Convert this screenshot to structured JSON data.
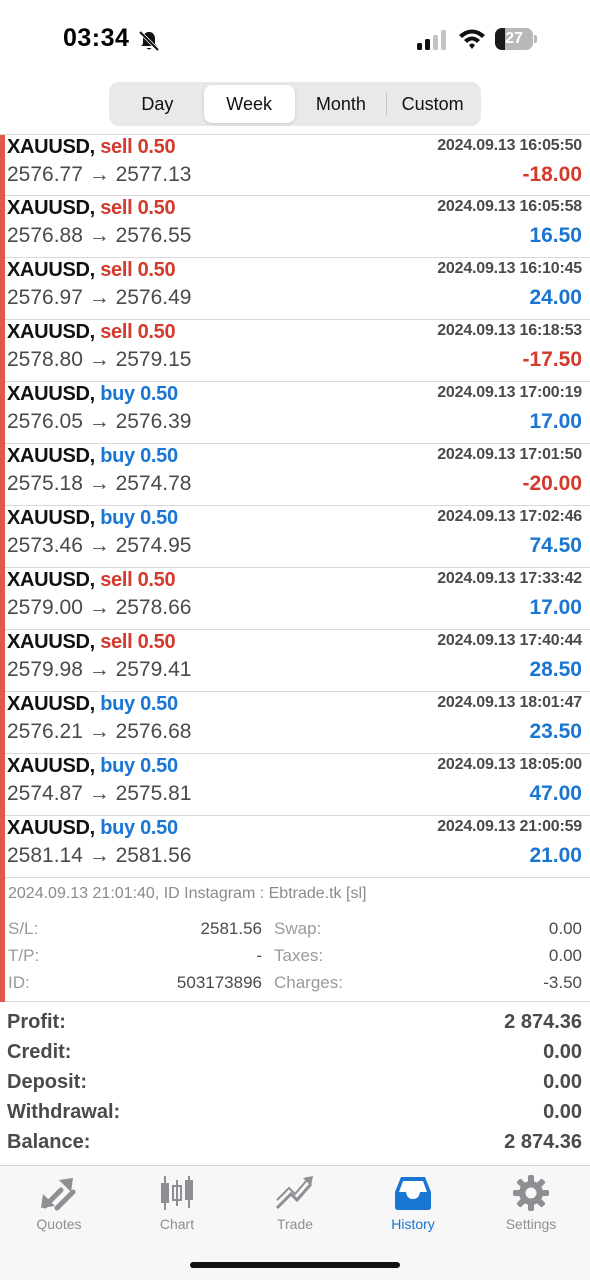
{
  "status_bar": {
    "time": "03:34",
    "battery": "27",
    "battery_level": 0.27
  },
  "period_tabs": [
    {
      "label": "Day",
      "active": false
    },
    {
      "label": "Week",
      "active": true
    },
    {
      "label": "Month",
      "active": false
    },
    {
      "label": "Custom",
      "active": false
    }
  ],
  "colors": {
    "sell": "#d33a2c",
    "buy": "#1976d2",
    "accent": "#1976d2",
    "row_marker": "#e0584c"
  },
  "deals": [
    {
      "symbol": "XAUUSD,",
      "side": "sell 0.50",
      "type": "sell",
      "time": "2024.09.13 16:05:50",
      "prices": "2576.77 → 2577.13",
      "profit": "-18.00",
      "profit_sign": "negative"
    },
    {
      "symbol": "XAUUSD,",
      "side": "sell 0.50",
      "type": "sell",
      "time": "2024.09.13 16:05:58",
      "prices": "2576.88 → 2576.55",
      "profit": "16.50",
      "profit_sign": "positive"
    },
    {
      "symbol": "XAUUSD,",
      "side": "sell 0.50",
      "type": "sell",
      "time": "2024.09.13 16:10:45",
      "prices": "2576.97 → 2576.49",
      "profit": "24.00",
      "profit_sign": "positive"
    },
    {
      "symbol": "XAUUSD,",
      "side": "sell 0.50",
      "type": "sell",
      "time": "2024.09.13 16:18:53",
      "prices": "2578.80 → 2579.15",
      "profit": "-17.50",
      "profit_sign": "negative"
    },
    {
      "symbol": "XAUUSD,",
      "side": "buy 0.50",
      "type": "buy",
      "time": "2024.09.13 17:00:19",
      "prices": "2576.05 → 2576.39",
      "profit": "17.00",
      "profit_sign": "positive"
    },
    {
      "symbol": "XAUUSD,",
      "side": "buy 0.50",
      "type": "buy",
      "time": "2024.09.13 17:01:50",
      "prices": "2575.18 → 2574.78",
      "profit": "-20.00",
      "profit_sign": "negative"
    },
    {
      "symbol": "XAUUSD,",
      "side": "buy 0.50",
      "type": "buy",
      "time": "2024.09.13 17:02:46",
      "prices": "2573.46 → 2574.95",
      "profit": "74.50",
      "profit_sign": "positive"
    },
    {
      "symbol": "XAUUSD,",
      "side": "sell 0.50",
      "type": "sell",
      "time": "2024.09.13 17:33:42",
      "prices": "2579.00 → 2578.66",
      "profit": "17.00",
      "profit_sign": "positive"
    },
    {
      "symbol": "XAUUSD,",
      "side": "sell 0.50",
      "type": "sell",
      "time": "2024.09.13 17:40:44",
      "prices": "2579.98 → 2579.41",
      "profit": "28.50",
      "profit_sign": "positive"
    },
    {
      "symbol": "XAUUSD,",
      "side": "buy 0.50",
      "type": "buy",
      "time": "2024.09.13 18:01:47",
      "prices": "2576.21 → 2576.68",
      "profit": "23.50",
      "profit_sign": "positive"
    },
    {
      "symbol": "XAUUSD,",
      "side": "buy 0.50",
      "type": "buy",
      "time": "2024.09.13 18:05:00",
      "prices": "2574.87 → 2575.81",
      "profit": "47.00",
      "profit_sign": "positive"
    },
    {
      "symbol": "XAUUSD,",
      "side": "buy 0.50",
      "type": "buy",
      "time": "2024.09.13 21:00:59",
      "prices": "2581.14 → 2581.56",
      "profit": "21.00",
      "profit_sign": "positive"
    }
  ],
  "details": {
    "comment": "2024.09.13 21:01:40, ID Instagram : Ebtrade.tk [sl]",
    "sl_label": "S/L:",
    "sl_value": "2581.56",
    "tp_label": "T/P:",
    "tp_value": "-",
    "id_label": "ID:",
    "id_value": "503173896",
    "swap_label": "Swap:",
    "swap_value": "0.00",
    "taxes_label": "Taxes:",
    "taxes_value": "0.00",
    "charges_label": "Charges:",
    "charges_value": "-3.50"
  },
  "summary": [
    {
      "label": "Profit:",
      "value": "2 874.36"
    },
    {
      "label": "Credit:",
      "value": "0.00"
    },
    {
      "label": "Deposit:",
      "value": "0.00"
    },
    {
      "label": "Withdrawal:",
      "value": "0.00"
    },
    {
      "label": "Balance:",
      "value": "2 874.36"
    }
  ],
  "tabbar": [
    {
      "label": "Quotes",
      "icon": "quotes-icon",
      "active": false
    },
    {
      "label": "Chart",
      "icon": "chart-icon",
      "active": false
    },
    {
      "label": "Trade",
      "icon": "trade-icon",
      "active": false
    },
    {
      "label": "History",
      "icon": "history-icon",
      "active": true
    },
    {
      "label": "Settings",
      "icon": "settings-icon",
      "active": false
    }
  ]
}
